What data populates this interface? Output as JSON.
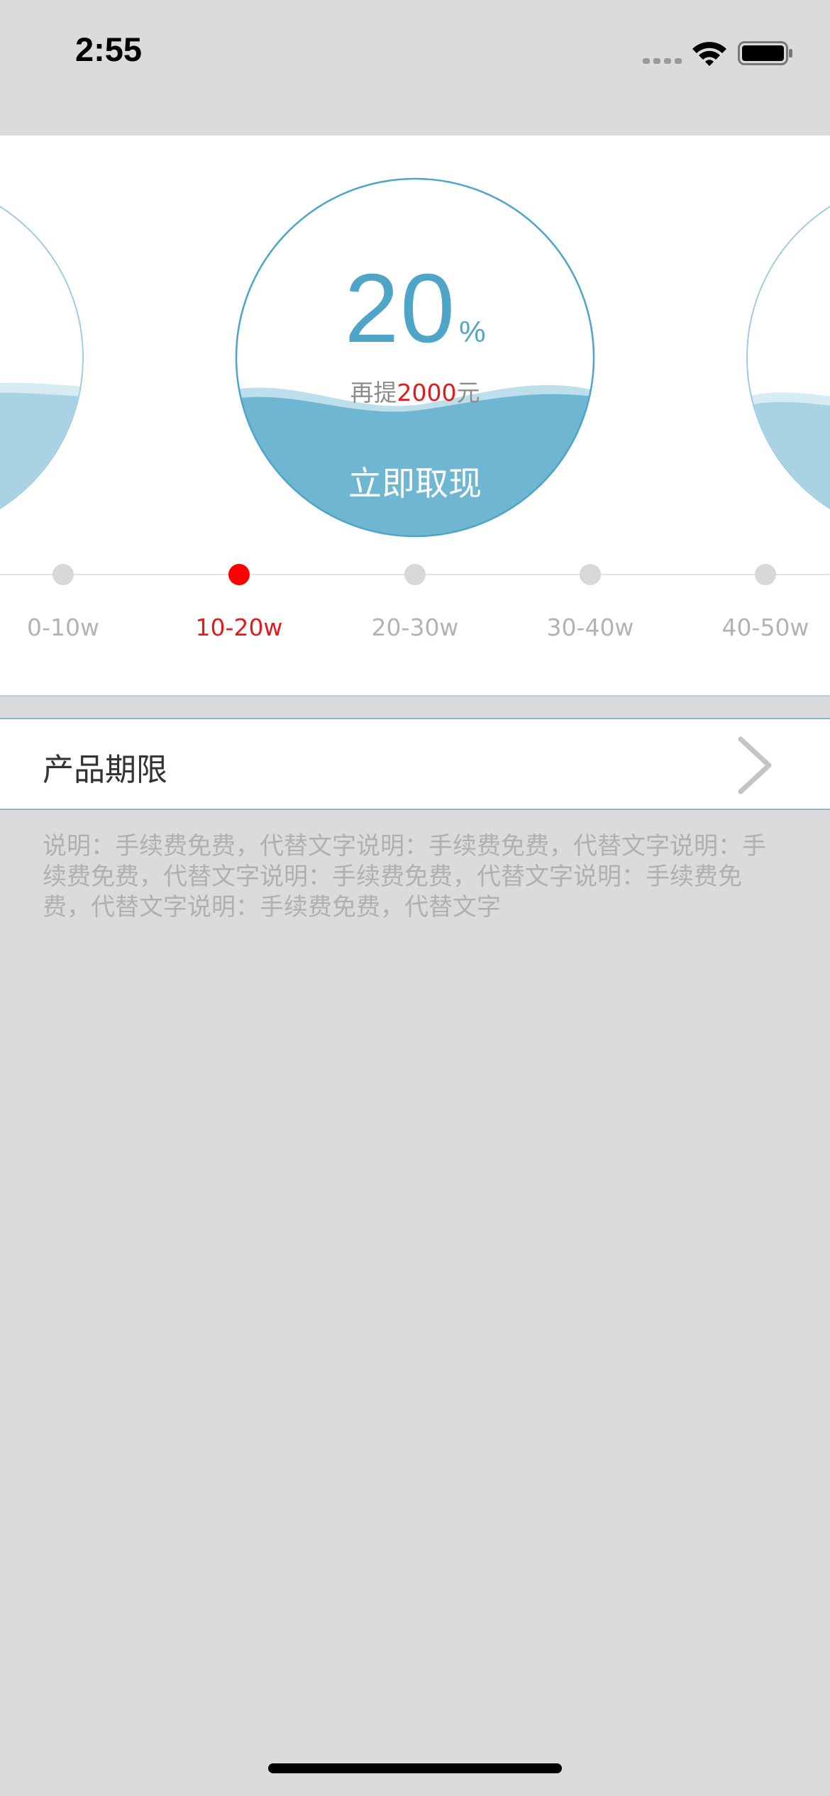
{
  "status_bar": {
    "time": "2:55"
  },
  "gauge": {
    "percent": "20",
    "percent_unit": "%",
    "hint_prefix": "再提",
    "hint_amount": "2000",
    "hint_suffix": "元",
    "cta_label": "立即取现",
    "wave_color": "#6fb6d2",
    "ring_color": "#4ea5c8"
  },
  "tiers": [
    {
      "label": "0-10w",
      "active": false
    },
    {
      "label": "10-20w",
      "active": true
    },
    {
      "label": "20-30w",
      "active": false
    },
    {
      "label": "30-40w",
      "active": false
    },
    {
      "label": "40-50w",
      "active": false
    }
  ],
  "product_row": {
    "label": "产品期限"
  },
  "note": "说明：手续费免费，代替文字说明：手续费免费，代替文字说明：手续费免费，代替文字说明：手续费免费，代替文字说明：手续费免费，代替文字说明：手续费免费，代替文字",
  "colors": {
    "accent": "#4ea5c8",
    "highlight": "#ff0000",
    "background": "#dadbdd"
  }
}
